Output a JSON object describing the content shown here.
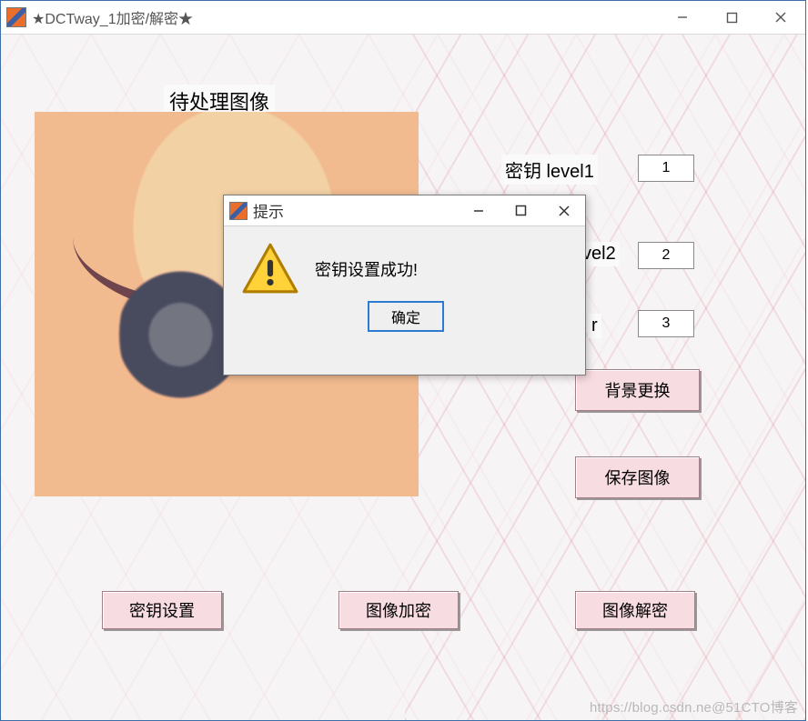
{
  "window": {
    "title": "★DCTway_1加密/解密★"
  },
  "image_title": "待处理图像",
  "fields": {
    "level1": {
      "label": "密钥 level1",
      "value": "1"
    },
    "level2": {
      "label": "vel2",
      "value": "2"
    },
    "level3": {
      "label": "r",
      "value": "3"
    }
  },
  "buttons": {
    "change_bg": "背景更换",
    "save_img": "保存图像",
    "key_set": "密钥设置",
    "img_enc": "图像加密",
    "img_dec": "图像解密"
  },
  "dialog": {
    "title": "提示",
    "message": "密钥设置成功!",
    "ok": "确定"
  },
  "watermark": "https://blog.csdn.ne@51CTO博客"
}
